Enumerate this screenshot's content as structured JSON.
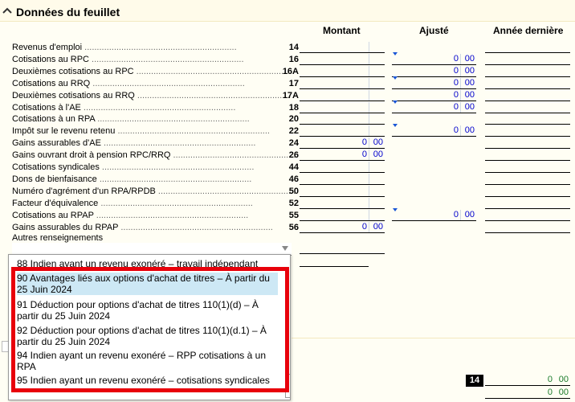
{
  "section": {
    "title": "Données du feuillet"
  },
  "columns": {
    "montant": "Montant",
    "ajuste": "Ajusté",
    "annee": "Année dernière"
  },
  "rows": [
    {
      "label": "Revenus d'emploi",
      "code": "14",
      "montant": "",
      "ajuste": "",
      "marker": false
    },
    {
      "label": "Cotisations au RPC",
      "code": "16",
      "montant": "",
      "ajuste": "0",
      "marker": true
    },
    {
      "label": "Deuxièmes cotisations au RPC",
      "code": "16A",
      "montant": "",
      "ajuste": "0",
      "marker": false
    },
    {
      "label": "Cotisations au RRQ",
      "code": "17",
      "montant": "",
      "ajuste": "0",
      "marker": true
    },
    {
      "label": "Deuxièmes cotisations au RRQ",
      "code": "17A",
      "montant": "",
      "ajuste": "0",
      "marker": false
    },
    {
      "label": "Cotisations à l'AE",
      "code": "18",
      "montant": "",
      "ajuste": "0",
      "marker": true
    },
    {
      "label": "Cotisations à un RPA",
      "code": "20",
      "montant": "",
      "ajuste": "",
      "marker": false
    },
    {
      "label": "Impôt sur le revenu retenu",
      "code": "22",
      "montant": "",
      "ajuste": "0",
      "marker": true
    },
    {
      "label": "Gains assurables d'AE",
      "code": "24",
      "montant": "0",
      "ajuste": "",
      "marker": false
    },
    {
      "label": "Gains ouvrant droit à pension RPC/RRQ",
      "code": "26",
      "montant": "0",
      "ajuste": "",
      "marker": false
    },
    {
      "label": "Cotisations syndicales",
      "code": "44",
      "montant": "",
      "ajuste": "",
      "marker": false
    },
    {
      "label": "Dons de bienfaisance",
      "code": "46",
      "montant": "",
      "ajuste": "",
      "marker": false
    },
    {
      "label": "Numéro d'agrément d'un RPA/RPDB",
      "code": "50",
      "montant": "",
      "ajuste": "",
      "marker": false
    },
    {
      "label": "Facteur d'équivalence",
      "code": "52",
      "montant": "",
      "ajuste": "",
      "marker": false
    },
    {
      "label": "Cotisations au RPAP",
      "code": "55",
      "montant": "",
      "ajuste": "0",
      "marker": true
    },
    {
      "label": "Gains assurables du RPAP",
      "code": "56",
      "montant": "0",
      "ajuste": "",
      "marker": false
    }
  ],
  "cents": "00",
  "other": {
    "label": "Autres renseignements"
  },
  "dropdown": {
    "items": [
      {
        "text": "88 Indien ayant un revenu exonéré – travail indépendant"
      },
      {
        "text": "90 Avantages liés aux options d'achat de titres  – À partir du 25 Juin 2024"
      },
      {
        "text": "91 Déduction pour options d'achat de titres 110(1)(d) – À partir du 25 Juin 2024"
      },
      {
        "text": "92 Déduction pour options d'achat de titres 110(1)(d.1) – À partir du 25 Juin 2024"
      },
      {
        "text": "94 Indien ayant un revenu exonéré – RPP cotisations à un RPA"
      },
      {
        "text": "95 Indien ayant un revenu exonéré – cotisations syndicales"
      }
    ]
  },
  "lower": {
    "code": "14",
    "value1": "0",
    "value2": "0"
  },
  "colors": {
    "highlight": "#e8000b",
    "selected": "#cde8f5",
    "value": "#0000cc",
    "green": "#1a7a2a"
  }
}
